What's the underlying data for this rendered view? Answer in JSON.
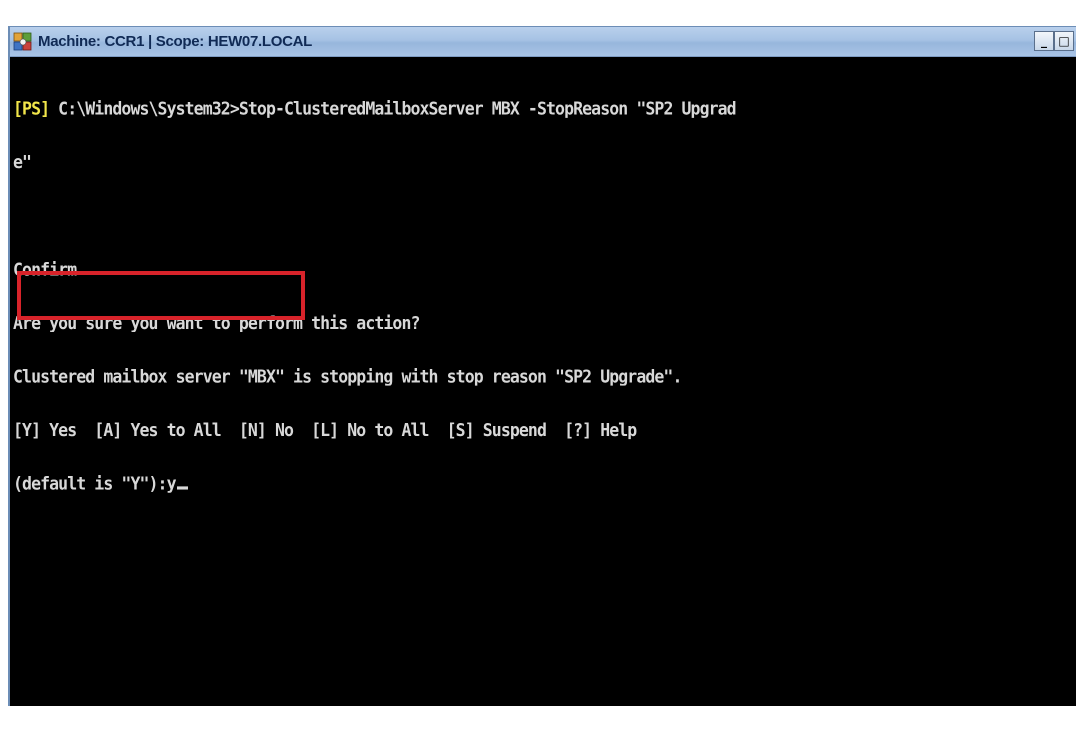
{
  "window": {
    "title": "Machine: CCR1 | Scope: HEW07.LOCAL",
    "icon": "powershell-app-icon",
    "controls": {
      "minimize_label": "_",
      "maximize_label": "□"
    }
  },
  "console": {
    "line1_tag": "[PS]",
    "line1_text": " C:\\Windows\\System32>Stop-ClusteredMailboxServer MBX -StopReason \"SP2 Upgrad",
    "line2_text": "e\"",
    "line3_text": "",
    "line4_text": "Confirm",
    "line5_text": "Are you sure you want to perform this action?",
    "line6_text": "Clustered mailbox server \"MBX\" is stopping with stop reason \"SP2 Upgrade\".",
    "line7_text": "[Y] Yes  [A] Yes to All  [N] No  [L] No to All  [S] Suspend  [?] Help",
    "prompt_text": "(default is \"Y\"):y"
  },
  "annotation": {
    "highlight_color": "#d8232a"
  },
  "colors": {
    "console_bg": "#000000",
    "console_fg": "#d8d8d8",
    "ps_tag": "#f2e64a",
    "titlebar": "#a6c2e4"
  }
}
